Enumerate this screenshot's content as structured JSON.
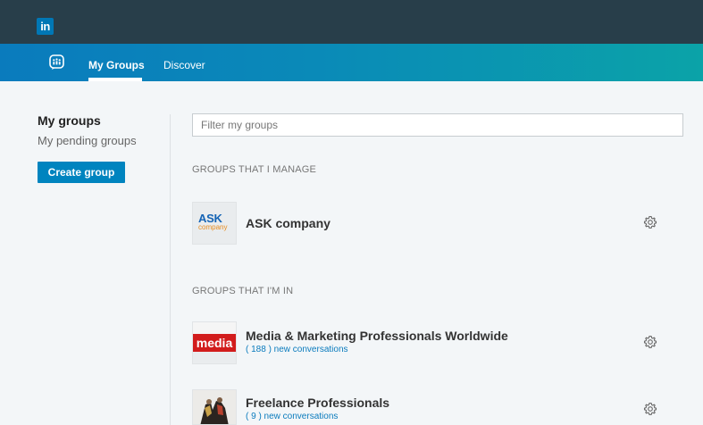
{
  "header": {
    "logo_text": "in"
  },
  "nav": {
    "tabs": [
      {
        "label": "My Groups",
        "active": true
      },
      {
        "label": "Discover",
        "active": false
      }
    ]
  },
  "sidebar": {
    "title": "My groups",
    "pending_link": "My pending groups",
    "create_button": "Create group"
  },
  "main": {
    "filter": {
      "placeholder": "Filter my groups",
      "value": ""
    },
    "manage_section": {
      "heading": "GROUPS THAT I MANAGE",
      "groups": [
        {
          "name": "ASK company",
          "logo_top": "ASK",
          "logo_bottom": "company"
        }
      ]
    },
    "member_section": {
      "heading": "GROUPS THAT I'M IN",
      "groups": [
        {
          "name": "Media & Marketing Professionals Worldwide",
          "logo_text": "media",
          "conversations": "( 188 ) new conversations"
        },
        {
          "name": "Freelance Professionals",
          "conversations": "( 9 ) new conversations"
        }
      ]
    }
  },
  "colors": {
    "topbar": "#283e4a",
    "nav_start": "#0a7bbd",
    "nav_end": "#0ba3a8",
    "primary_button": "#0084bf",
    "link": "#0a7bbd",
    "media_red": "#d21c1c"
  }
}
